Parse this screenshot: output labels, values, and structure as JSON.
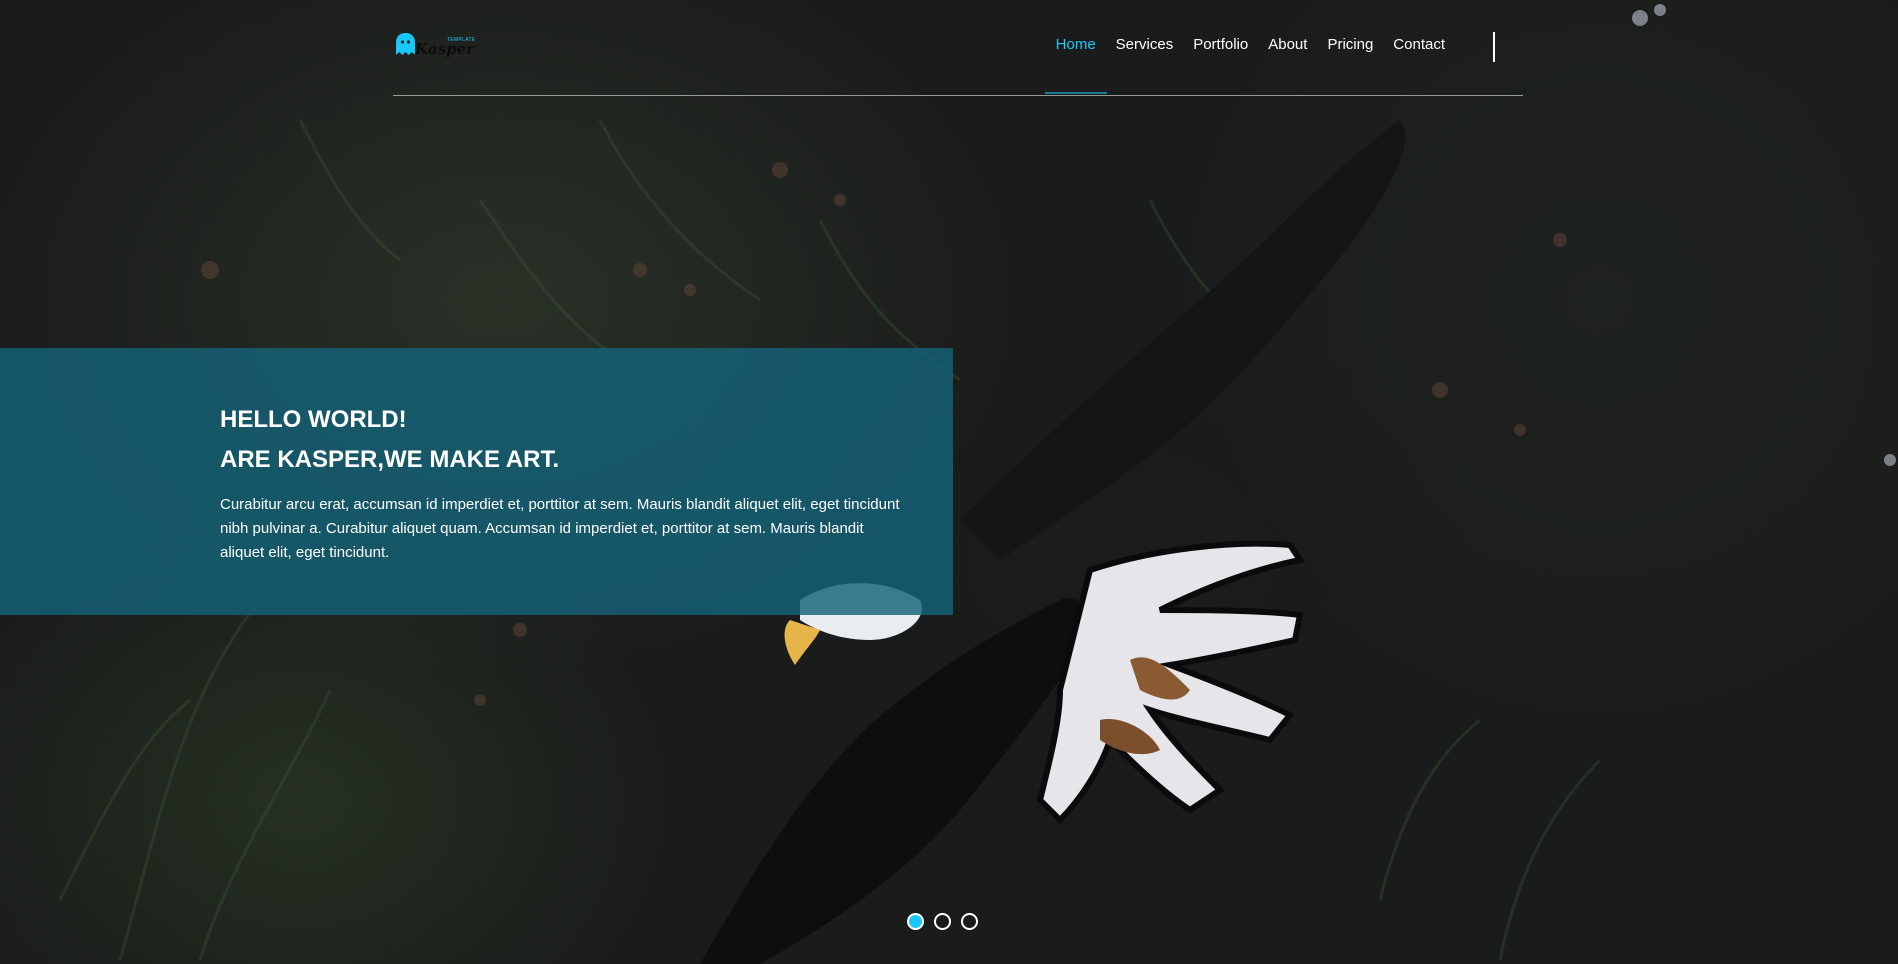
{
  "brand": {
    "logo_text": "Kasper",
    "logo_tag": "TEMPLATE",
    "accent_color": "#19c8fa"
  },
  "nav": {
    "items": [
      {
        "label": "Home",
        "active": true
      },
      {
        "label": "Services",
        "active": false
      },
      {
        "label": "Portfolio",
        "active": false
      },
      {
        "label": "About",
        "active": false
      },
      {
        "label": "Pricing",
        "active": false
      },
      {
        "label": "Contact",
        "active": false
      }
    ]
  },
  "hero": {
    "title_line1": "HELLO WORLD!",
    "title_line2": "ARE KASPER,WE MAKE ART.",
    "description": "Curabitur arcu erat, accumsan id imperdiet et, porttitor at sem. Mauris blandit aliquet elit, eget tincidunt nibh pulvinar a. Curabitur aliquet quam. Accumsan id imperdiet et, porttitor at sem. Mauris blandit aliquet elit, eget tincidunt.",
    "background_image": "eagle in flight over dark foliage",
    "box_color": "#136278"
  },
  "slider": {
    "bullets": [
      {
        "active": true
      },
      {
        "active": false
      },
      {
        "active": false
      }
    ]
  }
}
